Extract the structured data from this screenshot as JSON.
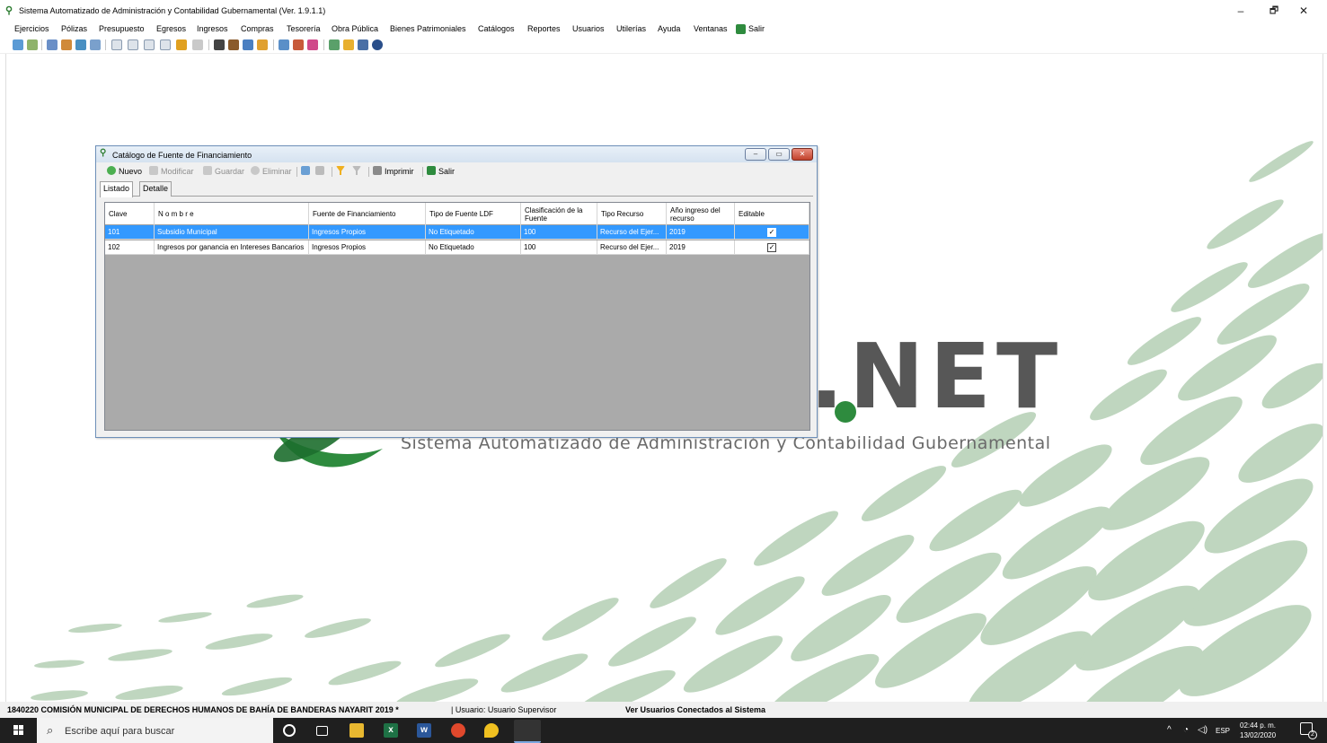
{
  "window": {
    "title": "Sistema Automatizado de Administración y Contabilidad Gubernamental  (Ver. 1.9.1.1)",
    "minimize": "–",
    "restore": "🗗",
    "close": "✕"
  },
  "menu": [
    "Ejercicios",
    "Pólizas",
    "Presupuesto",
    "Egresos",
    "Ingresos",
    "Compras",
    "Tesorería",
    "Obra Pública",
    "Bienes Patrimoniales",
    "Catálogos",
    "Reportes",
    "Usuarios",
    "Utilerías",
    "Ayuda",
    "Ventanas",
    "Salir"
  ],
  "background": {
    "logo_text": ".NET",
    "subtitle": "Sistema Automatizado de Administración y Contabilidad Gubernamental"
  },
  "child": {
    "title": "Catálogo de Fuente de Financiamiento",
    "toolbar": {
      "nuevo": "Nuevo",
      "modificar": "Modificar",
      "guardar": "Guardar",
      "eliminar": "Eliminar",
      "imprimir": "Imprimir",
      "salir": "Salir"
    },
    "tabs": [
      "Listado",
      "Detalle"
    ],
    "columns": [
      "Clave",
      "N o m b r e",
      "Fuente de Financiamiento",
      "Tipo de Fuente LDF",
      "Clasificación de la Fuente",
      "Tipo Recurso",
      "Año ingreso del recurso",
      "Editable"
    ],
    "rows": [
      {
        "clave": "101",
        "nombre": "Subsidio Municipal",
        "fuente": "Ingresos Propios",
        "tipo_ldf": "No Etiquetado",
        "clasificacion": "100",
        "tipo_recurso": "Recurso del Ejer...",
        "anio": "2019",
        "editable": true,
        "selected": true
      },
      {
        "clave": "102",
        "nombre": "Ingresos por ganancia en Intereses Bancarios",
        "fuente": "Ingresos Propios",
        "tipo_ldf": "No Etiquetado",
        "clasificacion": "100",
        "tipo_recurso": "Recurso del Ejer...",
        "anio": "2019",
        "editable": true,
        "selected": false
      }
    ]
  },
  "status": {
    "entity": "1840220 COMISIÓN MUNICIPAL DE DERECHOS HUMANOS DE BAHÍA DE BANDERAS NAYARIT  2019  *",
    "user": "| Usuario: Usuario Supervisor",
    "connected": "Ver Usuarios Conectados al Sistema"
  },
  "taskbar": {
    "search_placeholder": "Escribe aquí para buscar",
    "lang": "ESP",
    "time": "02:44 p. m.",
    "date": "13/02/2020",
    "notifications": "2"
  },
  "colors": {
    "selection": "#3399ff",
    "grid_bg": "#aaaaaa",
    "brand_green": "#2e8b3e"
  }
}
